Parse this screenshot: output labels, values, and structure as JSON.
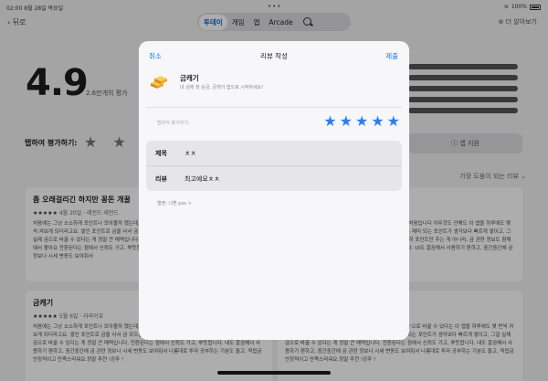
{
  "status": {
    "time": "02:00",
    "date": "8월 28일 목요일",
    "battery": "100%"
  },
  "nav": {
    "back_label": "뒤로",
    "more_label": "더 알아보기",
    "tabs": [
      "투데이",
      "게임",
      "앱",
      "Arcade"
    ],
    "active_tab": "투데이"
  },
  "ratings": {
    "average": "4.9",
    "count_label": "2.6만개의 평가",
    "tap_to_rate_label": "탭하여 평가하기:",
    "tap_stars": "★ ★ ★",
    "app_support_label": "앱 지원",
    "sort_label": "가장 도움이 되는 리뷰"
  },
  "reviews": [
    {
      "title": "좀 오래걸리긴 하지만 꽁돈 개꿀",
      "stars": "★★★★★",
      "meta": "4월 20일 · 레전드 레전드",
      "body": "처음에는 그냥 소소하게 포인트나 모아볼까 했는데, 이런건 처음입니다 아무것도 안해도 이 앱을 하루에도 몇 번씩 켜보게 되더라고요. 쌓인 포인트로 금을 사서 금 모으는 재미 되는 포인트가 생각보다 빠르게 쌓이고, 그걸 실제 금으로 바꿀 수 있다는 게 정말 큰 매력입니다. 단순히 포인트만 주는 게 아니라, 금 관련 정보도 함께 제공돼서 좋아요 전환된다는 점에서 신뢰도 가고, 뿌듯합니다. UI도 깔끔해서 사용하기 편하고, 중간중간에 금 관련 정보나 시세 변동도 보여줘서"
    },
    {
      "title": "금캐기",
      "stars": "★★★★★",
      "meta": "5월 6일 · 라라아호",
      "body": "처음에는 그냥 소소하게 포인트나 모아볼까 했는데, 실제 '금'으로 바꿀 수 있다는 이 앱을 하루에도 몇 번씩 켜보게 되더라고요. 쌓인 포인트로 금을 사서 금 모으는 재미 되는 포인트가 생각보다 빠르게 쌓이고, 그걸 실제 금으로 바꿀 수 있다는 게 정말 큰 매력입니다. 전환된다는 점에서 신뢰도 가고, 뿌듯합니다. 내도 깔끔해서 사용하기 편하고, 중간중간에 금 관련 정보나 시세 변동도 보여줘서 나름대로 투자 공부하는 기분도 들고, 적립금 안정적이고 만족스러워요.정말 추천 !강추 !"
    }
  ],
  "modal": {
    "cancel_label": "취소",
    "title": "리뷰 작성",
    "submit_label": "제출",
    "app_name": "금캐기",
    "app_desc": "내 성에 첫 순금, 금캐기 앱으로 시작하세요!",
    "rate_label": "탭하여 평가하기:",
    "stars": [
      "★",
      "★",
      "★",
      "★",
      "★"
    ],
    "rating_value": 5,
    "title_field_label": "제목",
    "title_field_value": "ㅊㅊ",
    "review_field_label": "리뷰",
    "review_field_value": "최고예요ㅊㅊ",
    "nickname_label": "별명: 나쁜 pes >"
  },
  "colors": {
    "accent": "#0a7aff",
    "star": "#2f7cf6",
    "gold": "#e9a82a"
  }
}
